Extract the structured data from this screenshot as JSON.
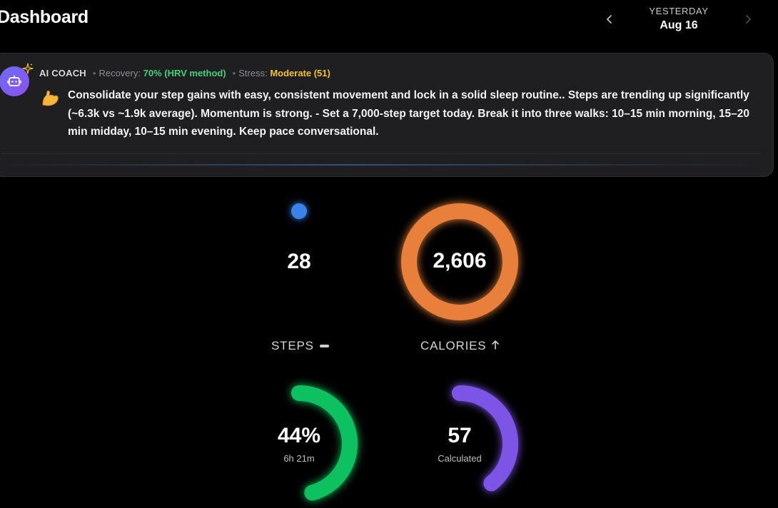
{
  "header": {
    "title": "Dashboard"
  },
  "date_nav": {
    "relative": "YESTERDAY",
    "date": "Aug 16",
    "prev_icon": "chevron-left-icon",
    "next_icon": "chevron-right-icon"
  },
  "coach": {
    "label": "AI COACH",
    "recovery_label": "Recovery:",
    "recovery_value": "70% (HRV method)",
    "stress_label": "Stress:",
    "stress_value": "Moderate (51)",
    "message": "Consolidate your step gains with easy, consistent movement and lock in a solid sleep routine.. Steps are trending up significantly (~6.3k vs ~1.9k average). Momentum is strong. - Set a 7,000-step target today. Break it into three walks: 10–15 min morning, 15–20 min midday, 10–15 min evening. Keep pace conversational.",
    "colors": {
      "recovery": "#3ed37a",
      "stress": "#f2c12e"
    }
  },
  "metrics": {
    "steps": {
      "value": "28",
      "label": "STEPS",
      "trend_icon": "dash-icon",
      "progress": 0.004,
      "color": "#3a82e8"
    },
    "calories": {
      "value": "2,606",
      "label": "CALORIES",
      "trend_icon": "arrow-up-icon",
      "progress": 1.0,
      "color": "#e8803a"
    },
    "sleep": {
      "value": "44%",
      "sub": "6h 21m",
      "progress": 0.44,
      "color": "#0fc060"
    },
    "other": {
      "value": "57",
      "sub": "Calculated",
      "progress": 0.57,
      "color": "#7b55e6"
    }
  }
}
